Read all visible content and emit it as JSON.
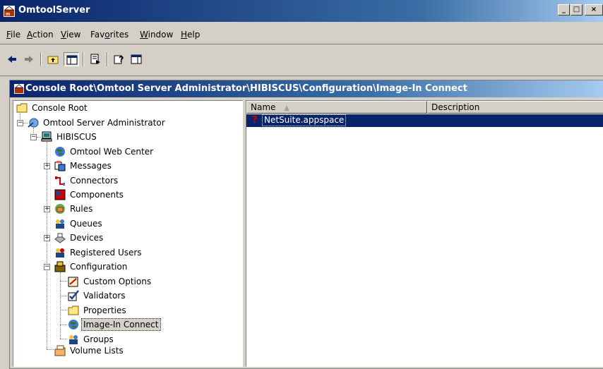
{
  "window": {
    "title": "OmtoolServer",
    "controls": [
      "_",
      "□",
      "×"
    ]
  },
  "menu": {
    "items": [
      {
        "label": "File",
        "mnemonic": "F"
      },
      {
        "label": "Action",
        "mnemonic": "A"
      },
      {
        "label": "View",
        "mnemonic": "V"
      },
      {
        "label": "Favorites",
        "mnemonic": "o"
      },
      {
        "label": "Window",
        "mnemonic": "W"
      },
      {
        "label": "Help",
        "mnemonic": "H"
      }
    ]
  },
  "toolbar": {
    "back_icon": "back-arrow-icon",
    "forward_icon": "forward-arrow-icon",
    "up_icon": "up-one-level-icon",
    "tree_icon": "show-hide-console-tree-icon",
    "export_icon": "export-list-icon",
    "help_icon": "help-icon",
    "action_pane_icon": "show-hide-action-pane-icon"
  },
  "child": {
    "title": "Console Root\\Omtool Server Administrator\\HIBISCUS\\Configuration\\Image-In Connect"
  },
  "tree": {
    "nodes": [
      {
        "label": "Console Root",
        "icon": "folder-icon"
      },
      {
        "label": "Omtool Server Administrator",
        "icon": "omtool-admin-icon"
      },
      {
        "label": "HIBISCUS",
        "icon": "computer-icon"
      },
      {
        "label": "Omtool Web Center",
        "icon": "globe-icon"
      },
      {
        "label": "Messages",
        "icon": "messages-icon"
      },
      {
        "label": "Connectors",
        "icon": "connectors-icon"
      },
      {
        "label": "Components",
        "icon": "components-icon"
      },
      {
        "label": "Rules",
        "icon": "rules-icon"
      },
      {
        "label": "Queues",
        "icon": "queues-icon"
      },
      {
        "label": "Devices",
        "icon": "devices-icon"
      },
      {
        "label": "Registered Users",
        "icon": "users-icon"
      },
      {
        "label": "Configuration",
        "icon": "configuration-icon"
      },
      {
        "label": "Custom Options",
        "icon": "custom-options-icon"
      },
      {
        "label": "Validators",
        "icon": "checkmark-icon"
      },
      {
        "label": "Properties",
        "icon": "folder-icon"
      },
      {
        "label": "Image-In Connect",
        "icon": "globe-icon",
        "selected": true
      },
      {
        "label": "Groups",
        "icon": "groups-icon"
      },
      {
        "label": "Volume Lists",
        "icon": "volume-lists-icon"
      }
    ]
  },
  "list": {
    "columns": [
      {
        "label": "Name",
        "sort_indicator": "▲"
      },
      {
        "label": "Description"
      }
    ],
    "rows": [
      {
        "name": "NetSuite.appspace",
        "description": "",
        "icon": "unknown-question-icon",
        "icon_glyph": "?"
      }
    ]
  },
  "colors": {
    "title_active": "#0a246a",
    "title_gradient_end": "#a6caf0",
    "face": "#d4d0c8",
    "selection": "#0a246a"
  }
}
